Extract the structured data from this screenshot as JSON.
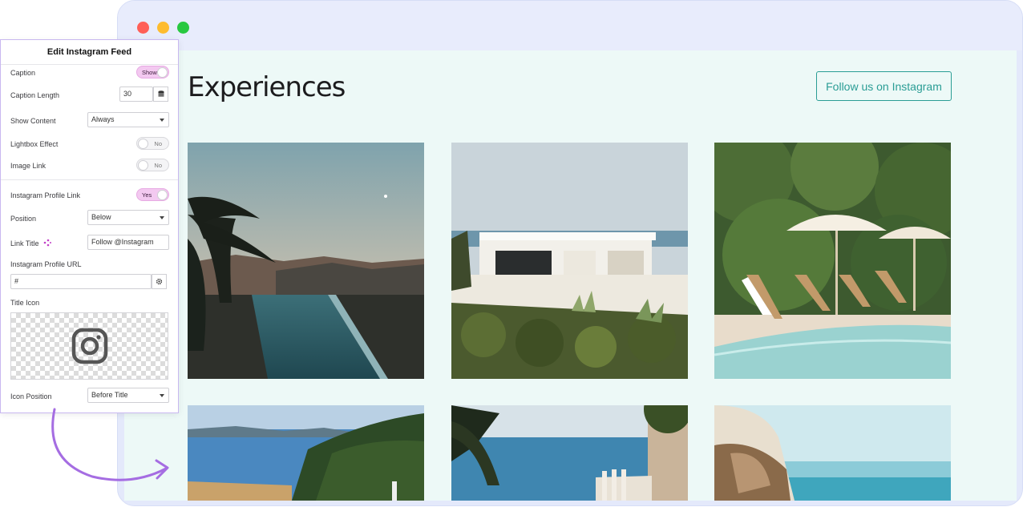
{
  "browser": {
    "page_title": "Experiences",
    "follow_button_label": "Follow us on Instagram"
  },
  "panel": {
    "title": "Edit Instagram Feed",
    "caption": {
      "label": "Caption",
      "toggle": "Show"
    },
    "caption_length": {
      "label": "Caption Length",
      "value": "30"
    },
    "show_content": {
      "label": "Show Content",
      "value": "Always"
    },
    "lightbox_effect": {
      "label": "Lightbox Effect",
      "toggle": "No"
    },
    "image_link": {
      "label": "Image Link",
      "toggle": "No"
    },
    "profile_link": {
      "label": "Instagram Profile Link",
      "toggle": "Yes"
    },
    "position": {
      "label": "Position",
      "value": "Below"
    },
    "link_title": {
      "label": "Link Title",
      "value": "Follow @Instagram"
    },
    "profile_url": {
      "label": "Instagram Profile URL",
      "value": "#"
    },
    "title_icon": {
      "label": "Title Icon",
      "icon": "instagram-icon"
    },
    "icon_position": {
      "label": "Icon Position",
      "value": "Before Title"
    }
  },
  "colors": {
    "accent_teal": "#2a9d95",
    "toggle_on": "#f3c9f0",
    "arrow": "#a56de2"
  }
}
